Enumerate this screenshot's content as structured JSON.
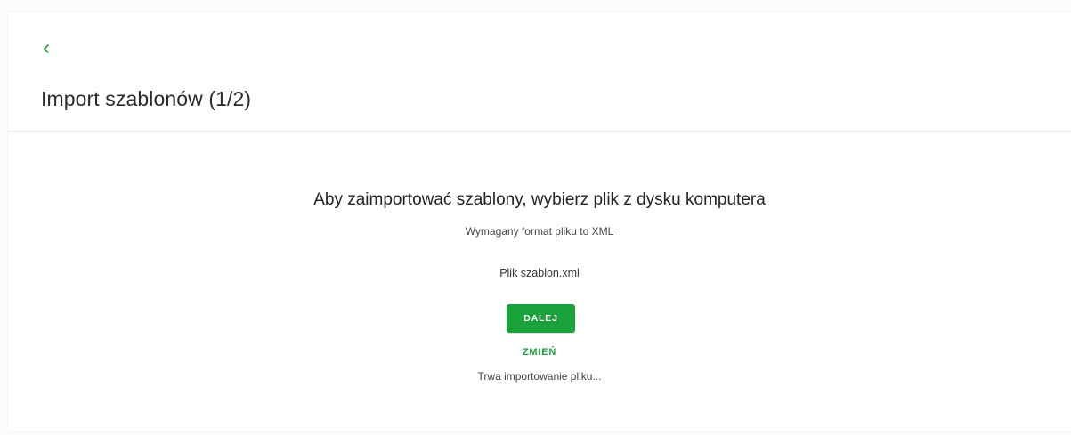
{
  "header": {
    "back_icon": "chevron-left-icon",
    "title": "Import szablonów (1/2)"
  },
  "main": {
    "heading": "Aby zaimportować szablony, wybierz plik z dysku komputera",
    "format_hint": "Wymagany format pliku to XML",
    "file_label": "Plik szablon.xml",
    "next_button_label": "DALEJ",
    "change_link_label": "ZMIEŃ",
    "status_text": "Trwa importowanie pliku..."
  },
  "colors": {
    "accent_green": "#1aa13a",
    "text_dark": "#2b2b2b",
    "divider": "#e9e9e9"
  }
}
